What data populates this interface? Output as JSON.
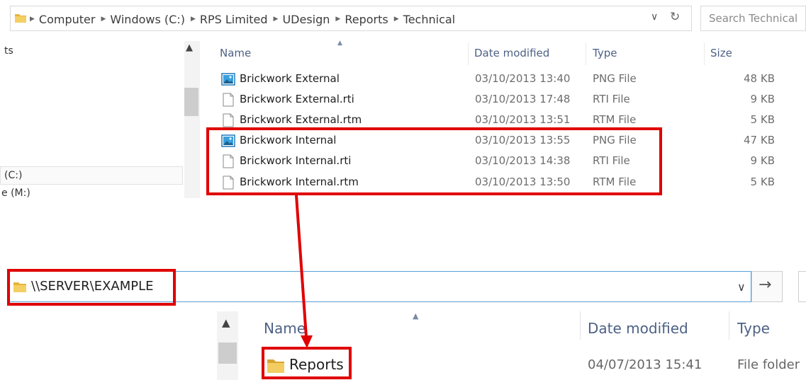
{
  "top_window": {
    "breadcrumbs": [
      "Computer",
      "Windows (C:)",
      "RPS Limited",
      "UDesign",
      "Reports",
      "Technical"
    ],
    "search_placeholder": "Search Technical",
    "nav_items": [
      "ts",
      "(C:)",
      "e (M:)"
    ],
    "columns": {
      "name": "Name",
      "date": "Date modified",
      "type": "Type",
      "size": "Size"
    },
    "files": [
      {
        "name": "Brickwork External",
        "date": "03/10/2013 13:40",
        "type": "PNG File",
        "size": "48 KB",
        "icon": "image-file-icon"
      },
      {
        "name": "Brickwork External.rti",
        "date": "03/10/2013 17:48",
        "type": "RTI File",
        "size": "9 KB",
        "icon": "document-file-icon"
      },
      {
        "name": "Brickwork External.rtm",
        "date": "03/10/2013 13:51",
        "type": "RTM File",
        "size": "5 KB",
        "icon": "document-file-icon"
      },
      {
        "name": "Brickwork Internal",
        "date": "03/10/2013 13:55",
        "type": "PNG File",
        "size": "47 KB",
        "icon": "image-file-icon"
      },
      {
        "name": "Brickwork Internal.rti",
        "date": "03/10/2013 14:38",
        "type": "RTI File",
        "size": "9 KB",
        "icon": "document-file-icon"
      },
      {
        "name": "Brickwork Internal.rtm",
        "date": "03/10/2013 13:50",
        "type": "RTM File",
        "size": "5 KB",
        "icon": "document-file-icon"
      }
    ]
  },
  "bottom_window": {
    "address": "\\\\SERVER\\EXAMPLE",
    "columns": {
      "name": "Name",
      "date": "Date modified",
      "type": "Type"
    },
    "rows": [
      {
        "name": "Reports",
        "date": "04/07/2013 15:41",
        "type": "File folder"
      }
    ]
  },
  "annotation_color": "#e00000"
}
